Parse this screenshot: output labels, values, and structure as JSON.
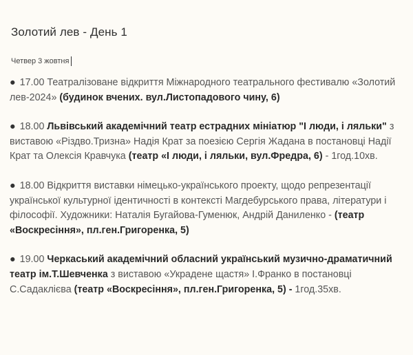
{
  "post": {
    "title": "Золотий лев - День 1",
    "date": "Четвер 3 жовтня"
  },
  "events": [
    {
      "bullet": "●",
      "time": "17.00",
      "t1": " Театралізоване відкриття Міжнародного театрального фестивалю «Золотий лев-2024» ",
      "venue": "(будинок вчених. вул.Листопадового чину, 6)"
    },
    {
      "bullet": "●",
      "time": "18.00",
      "company": " Львівський академічний театр естрадних мініатюр \"І люди, і ляльки\"",
      "t1": " з виставою «Різдво.Тризна» Надія Крат за поезією Сергія Жадана в постановці Надії Крат та Олексія Кравчука ",
      "venue": "(театр «І люди, і ляльки, вул.Фредра, 6)",
      "t2": " - 1год.10хв."
    },
    {
      "bullet": "●",
      "time": "18.00",
      "t1": " Відкриття виставки німецько-українського проекту, щодо репрезентації української культурної ідентичності в контексті Магдебурського права, літератури і філософії. Художники: Наталія Бугайова-Гуменюк, Андрій Даниленко - ",
      "venue": "(театр «Воскресіння», пл.ген.Григоренка, 5)"
    },
    {
      "bullet": "●",
      "time": "19.00",
      "company": " Черкаський академічний обласний український музично-драматичний театр ім.Т.Шевченка",
      "t1": " з виставою «Украдене щастя» І.Франко в постановці С.Садаклієва ",
      "venue": "(театр «Воскресіння», пл.ген.Григоренка, 5) -",
      "t2": " 1год.35хв."
    }
  ]
}
